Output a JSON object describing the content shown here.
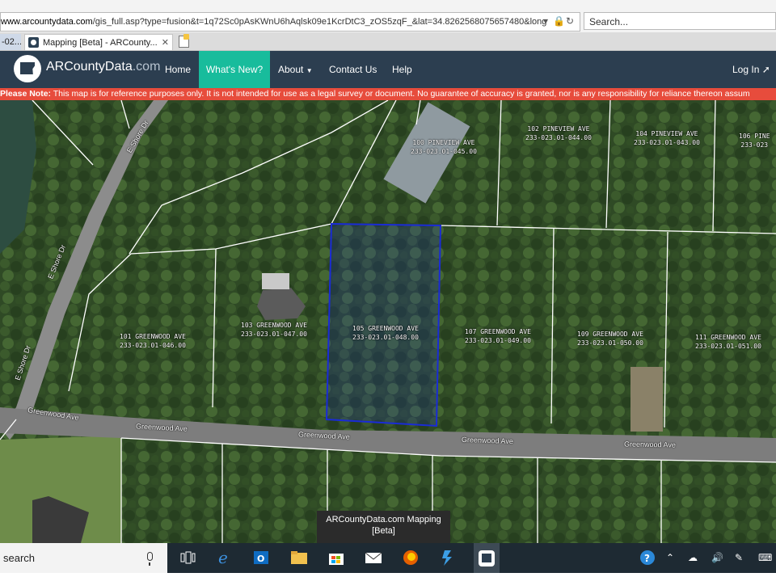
{
  "browser": {
    "url_domain": "www.arcountydata.com",
    "url_path": "/gis_full.asp?type=fusion&t=1q72Sc0pAsKWnU6hAqlsk09e1KcrDtC3_zOS5zqF_&lat=34.8262568075657480&long",
    "search_placeholder": "Search...",
    "tabs": [
      {
        "label": "-02..."
      },
      {
        "label": "Mapping [Beta] - ARCounty..."
      }
    ]
  },
  "site_nav": {
    "brand_main": "ARCountyData",
    "brand_suffix": ".com",
    "items": [
      {
        "label": "Home"
      },
      {
        "label": "What's New?"
      },
      {
        "label": "About"
      },
      {
        "label": "Contact Us"
      },
      {
        "label": "Help"
      }
    ],
    "login_label": "Log In"
  },
  "disclaimer": {
    "prefix": "Please Note:",
    "text": " This map is for reference purposes only. It is not intended for use as a legal survey or document. No guarantee of accuracy is granted, nor is any responsibility for reliance thereon assum"
  },
  "map": {
    "parcels": [
      {
        "address": "100 PINEVIEW AVE",
        "parcel_id": "233-023.01-045.00"
      },
      {
        "address": "102 PINEVIEW AVE",
        "parcel_id": "233-023.01-044.00"
      },
      {
        "address": "104 PINEVIEW AVE",
        "parcel_id": "233-023.01-043.00"
      },
      {
        "address": "106 PINE",
        "parcel_id": "233-023"
      },
      {
        "address": "101 GREENWOOD AVE",
        "parcel_id": "233-023.01-046.00"
      },
      {
        "address": "103 GREENWOOD AVE",
        "parcel_id": "233-023.01-047.00"
      },
      {
        "address": "105 GREENWOOD AVE",
        "parcel_id": "233-023.01-048.00"
      },
      {
        "address": "107 GREENWOOD AVE",
        "parcel_id": "233-023.01-049.00"
      },
      {
        "address": "109 GREENWOOD AVE",
        "parcel_id": "233-023.01-050.00"
      },
      {
        "address": "111 GREENWOOD AVE",
        "parcel_id": "233-023.01-051.00"
      }
    ],
    "streets": [
      {
        "name": "E Shore Dr"
      },
      {
        "name": "E Shore Dr"
      },
      {
        "name": "E Shore Dr"
      },
      {
        "name": "Greenwood Ave"
      },
      {
        "name": "Greenwood Ave"
      },
      {
        "name": "Greenwood Ave"
      },
      {
        "name": "Greenwood Ave"
      },
      {
        "name": "Greenwood Ave"
      }
    ],
    "selected_parcel": "105 GREENWOOD AVE"
  },
  "taskbar": {
    "search_text": "search",
    "tooltip_title": "ARCountyData.com Mapping [Beta]",
    "icons": [
      "task-view-icon",
      "edge-icon",
      "outlook-icon",
      "file-explorer-icon",
      "store-icon",
      "mail-icon",
      "firefox-icon",
      "app-icon",
      "arcountydata-app-icon"
    ],
    "tray_icons": [
      "help-icon",
      "chevron-up-icon",
      "cloud-icon",
      "volume-icon",
      "pen-icon",
      "keyboard-icon"
    ]
  },
  "colors": {
    "nav_bg": "#2c3e50",
    "nav_active": "#18bc9c",
    "disclaimer_bg": "#e74c3c",
    "selected_parcel_stroke": "#1a2bd6"
  }
}
